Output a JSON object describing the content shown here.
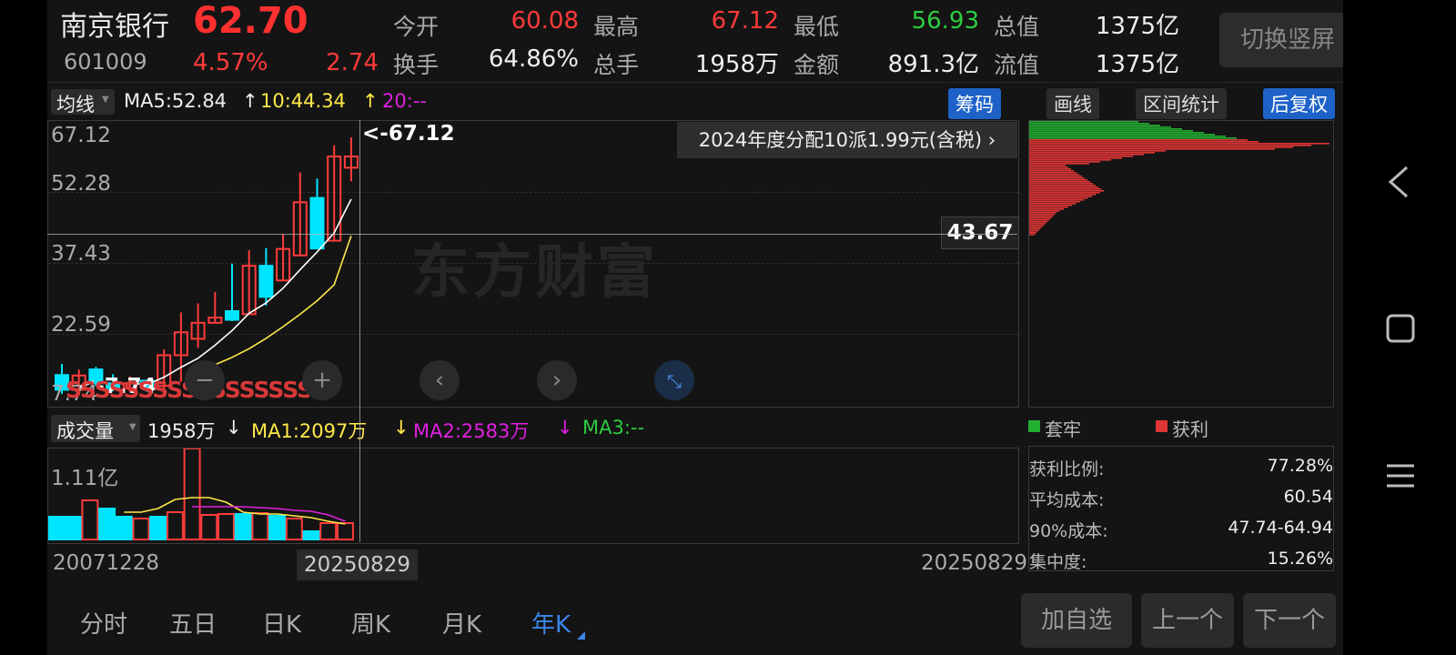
{
  "header": {
    "name": "南京银行",
    "price": "62.70",
    "code": "601009",
    "change_pct": "4.57%",
    "change_amt": "2.74",
    "open_label": "今开",
    "open": "60.08",
    "high_label": "最高",
    "high": "67.12",
    "low_label": "最低",
    "low": "56.93",
    "mktcap_label": "总值",
    "mktcap": "1375亿",
    "turnover_label": "换手",
    "turnover": "64.86%",
    "volume_label": "总手",
    "volume": "1958万",
    "amount_label": "金额",
    "amount": "891.3亿",
    "float_label": "流值",
    "float_cap": "1375亿",
    "switch_label": "切换竖屏"
  },
  "indicators": {
    "ma_label": "均线",
    "ma5": "MA5:52.84",
    "ma10": "10:44.34",
    "ma20": "20:--",
    "arrow_up": "↑",
    "chips_button": "筹码",
    "draw_button": "画线",
    "range_button": "区间统计",
    "adjust_button": "后复权"
  },
  "kline": {
    "y_labels": [
      "67.12",
      "52.28",
      "37.43",
      "22.59",
      "7.74"
    ],
    "max_marker": "<-67.12",
    "min_marker": "<-7.74",
    "crosshair_price": "43.67",
    "dividend_banner": "2024年度分配10派1.99元(含税) ›",
    "watermark": "东方财富",
    "s_markers": "SSSSSSSSSSSSSSSSS",
    "candles": [
      {
        "o": 12.1,
        "c": 8.7,
        "h": 14.7,
        "l": 7.74
      },
      {
        "o": 8.7,
        "c": 12.0,
        "h": 13.4,
        "l": 8.7
      },
      {
        "o": 13.4,
        "c": 10.2,
        "h": 14.0,
        "l": 9.5
      },
      {
        "o": 10.2,
        "c": 9.0,
        "h": 12.3,
        "l": 8.4
      },
      {
        "o": 9.0,
        "c": 10.2,
        "h": 11.8,
        "l": 8.2
      },
      {
        "o": 10.8,
        "c": 9.3,
        "h": 10.9,
        "l": 8.2
      },
      {
        "o": 9.6,
        "c": 16.7,
        "h": 18.0,
        "l": 8.2
      },
      {
        "o": 16.7,
        "c": 22.0,
        "h": 26.6,
        "l": 10.6
      },
      {
        "o": 20.5,
        "c": 24.2,
        "h": 28.7,
        "l": 18.4
      },
      {
        "o": 24.2,
        "c": 25.4,
        "h": 31.3,
        "l": 24.2
      },
      {
        "o": 26.9,
        "c": 24.9,
        "h": 37.9,
        "l": 24.6
      },
      {
        "o": 26.2,
        "c": 37.4,
        "h": 41.0,
        "l": 26.2
      },
      {
        "o": 37.4,
        "c": 30.2,
        "h": 41.5,
        "l": 28.2
      },
      {
        "o": 34.0,
        "c": 41.3,
        "h": 44.8,
        "l": 34.0
      },
      {
        "o": 39.8,
        "c": 52.1,
        "h": 59.0,
        "l": 39.8
      },
      {
        "o": 53.1,
        "c": 41.4,
        "h": 57.6,
        "l": 41.3
      },
      {
        "o": 43.2,
        "c": 62.7,
        "h": 65.3,
        "l": 43.2
      },
      {
        "o": 60.1,
        "c": 62.7,
        "h": 67.12,
        "l": 56.93
      }
    ],
    "ma_white": [
      null,
      null,
      null,
      null,
      10.2,
      9.9,
      11.6,
      13.9,
      16.0,
      19.0,
      22.4,
      26.4,
      28.8,
      32.2,
      36.5,
      40.6,
      45.0,
      52.84
    ],
    "ma_yellow": [
      null,
      null,
      null,
      null,
      null,
      null,
      null,
      null,
      null,
      14.5,
      16.2,
      18.2,
      20.6,
      23.3,
      26.2,
      29.3,
      33.0,
      44.34
    ]
  },
  "volume": {
    "label": "成交量",
    "value": "1958万",
    "ma1": "MA1:2097万",
    "ma2": "MA2:2583万",
    "ma3": "MA3:--",
    "arrow_down": "↓",
    "y_label": "1.11亿",
    "bars": [
      {
        "v": 0.25,
        "up": false
      },
      {
        "v": 0.25,
        "up": false
      },
      {
        "v": 0.43,
        "up": true
      },
      {
        "v": 0.34,
        "up": false
      },
      {
        "v": 0.25,
        "up": false
      },
      {
        "v": 0.23,
        "up": true
      },
      {
        "v": 0.25,
        "up": false
      },
      {
        "v": 0.3,
        "up": true
      },
      {
        "v": 1.0,
        "up": true
      },
      {
        "v": 0.27,
        "up": true
      },
      {
        "v": 0.28,
        "up": true
      },
      {
        "v": 0.28,
        "up": false
      },
      {
        "v": 0.29,
        "up": true
      },
      {
        "v": 0.26,
        "up": false
      },
      {
        "v": 0.23,
        "up": true
      },
      {
        "v": 0.09,
        "up": false
      },
      {
        "v": 0.18,
        "up": true
      },
      {
        "v": 0.18,
        "up": true
      }
    ],
    "ma_yellow": [
      null,
      null,
      null,
      null,
      0.3,
      0.3,
      0.34,
      0.44,
      0.46,
      0.46,
      0.41,
      0.3,
      0.28,
      0.28,
      0.26,
      0.24,
      0.2,
      0.17
    ],
    "ma_magenta": [
      null,
      null,
      null,
      null,
      null,
      null,
      null,
      null,
      0.36,
      0.36,
      0.36,
      0.36,
      0.35,
      0.34,
      0.32,
      0.31,
      0.27,
      0.2
    ]
  },
  "xaxis": {
    "start_date": "20071228",
    "cursor_date": "20250829",
    "end_date": "20250829"
  },
  "periods": [
    "分时",
    "五日",
    "日K",
    "周K",
    "月K",
    "年K"
  ],
  "active_period": "年K",
  "chips": {
    "legend_trapped": "套牢",
    "legend_profit": "获利",
    "stats": [
      {
        "label": "获利比例:",
        "value": "77.28%"
      },
      {
        "label": "平均成本:",
        "value": "60.54"
      },
      {
        "label": "90%成本:",
        "value": "47.74-64.94"
      },
      {
        "label": "集中度:",
        "value": "15.26%"
      }
    ]
  },
  "buttons": {
    "add": "加自选",
    "prev": "上一个",
    "next": "下一个"
  },
  "colors": {
    "up": "#ff3b3b",
    "down": "#00e5ff",
    "accent": "#1e62c8"
  }
}
